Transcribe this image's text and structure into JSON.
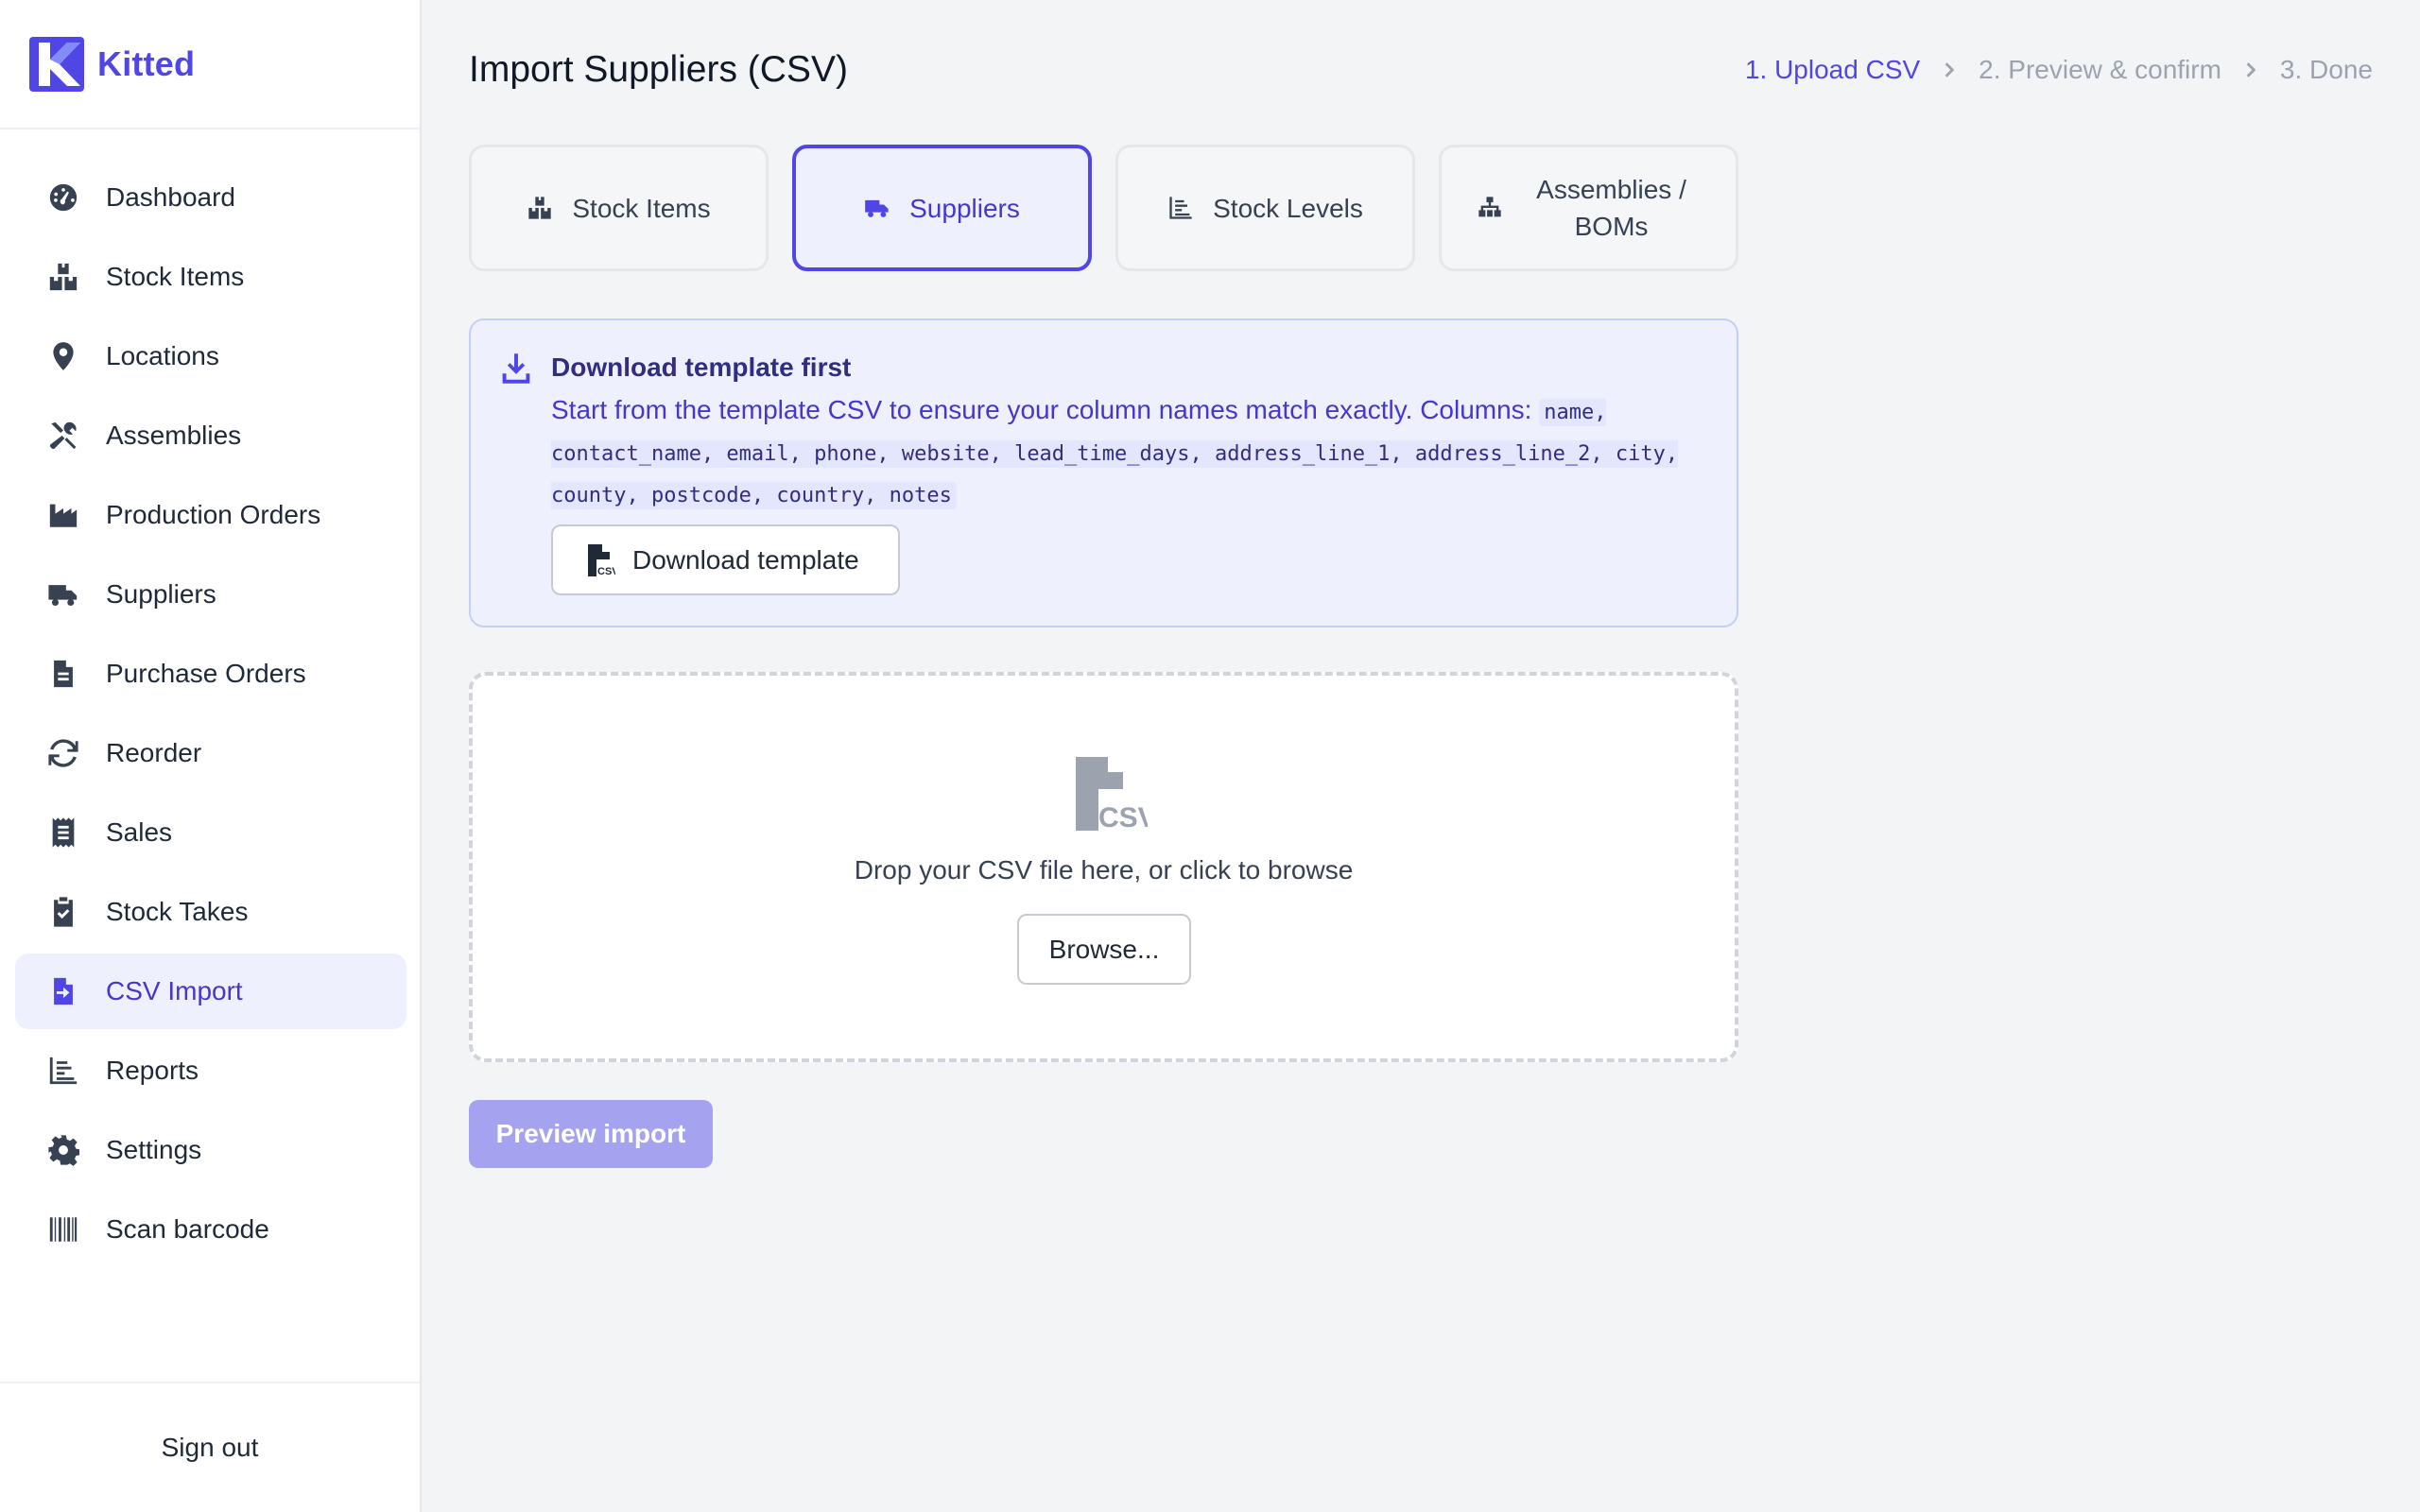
{
  "app": {
    "name": "Kitted",
    "brand_color": "#4f46e5"
  },
  "sidebar": {
    "items": [
      {
        "label": "Dashboard",
        "icon": "gauge-icon"
      },
      {
        "label": "Stock Items",
        "icon": "boxes-icon"
      },
      {
        "label": "Locations",
        "icon": "map-pin-icon"
      },
      {
        "label": "Assemblies",
        "icon": "tools-icon"
      },
      {
        "label": "Production Orders",
        "icon": "industry-icon"
      },
      {
        "label": "Suppliers",
        "icon": "truck-icon"
      },
      {
        "label": "Purchase Orders",
        "icon": "file-text-icon"
      },
      {
        "label": "Reorder",
        "icon": "refresh-icon"
      },
      {
        "label": "Sales",
        "icon": "receipt-icon"
      },
      {
        "label": "Stock Takes",
        "icon": "clipboard-check-icon"
      },
      {
        "label": "CSV Import",
        "icon": "file-import-icon",
        "active": true
      },
      {
        "label": "Reports",
        "icon": "chart-bar-icon"
      },
      {
        "label": "Settings",
        "icon": "gear-icon"
      },
      {
        "label": "Scan barcode",
        "icon": "barcode-icon"
      }
    ],
    "sign_out": "Sign out"
  },
  "page": {
    "title": "Import Suppliers (CSV)",
    "steps": [
      "1. Upload CSV",
      "2. Preview & confirm",
      "3. Done"
    ],
    "current_step": 0
  },
  "tabs": [
    {
      "label": "Stock Items",
      "icon": "boxes-icon"
    },
    {
      "label": "Suppliers",
      "icon": "truck-icon",
      "active": true
    },
    {
      "label": "Stock Levels",
      "icon": "chart-bar-icon"
    },
    {
      "label": "Assemblies / BOMs",
      "icon": "sitemap-icon"
    }
  ],
  "template_info": {
    "title": "Download template first",
    "text": "Start from the template CSV to ensure your column names match exactly. Columns:",
    "columns": "name, contact_name, email, phone, website, lead_time_days, address_line_1, address_line_2, city, county, postcode, country, notes",
    "button": "Download template"
  },
  "dropzone": {
    "text": "Drop your CSV file here, or click to browse",
    "browse": "Browse..."
  },
  "preview_button": "Preview import"
}
